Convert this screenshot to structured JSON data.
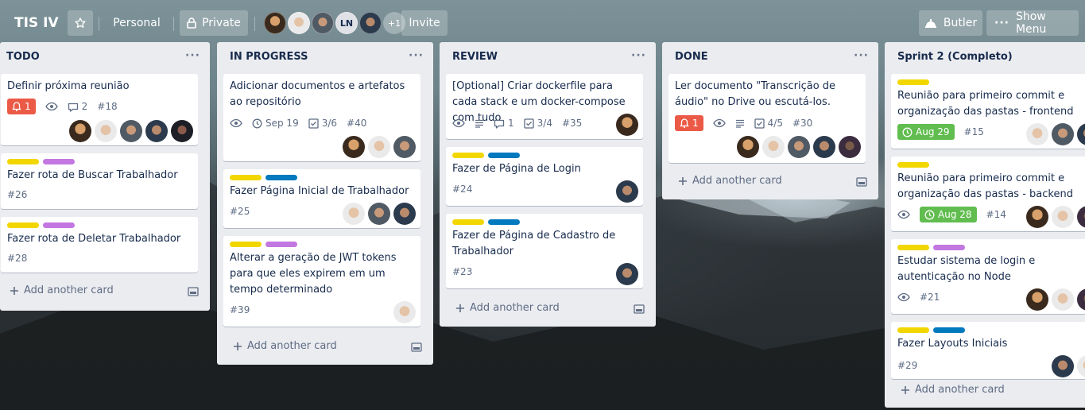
{
  "header": {
    "board_title": "TIS IV",
    "personal_label": "Personal",
    "private_label": "Private",
    "member_initials": "LN",
    "members_more": "+1",
    "invite_label": "Invite",
    "butler_label": "Butler",
    "show_menu_label": "Show Menu"
  },
  "lists": [
    {
      "title": "TODO",
      "add_card": "Add another card",
      "cards": [
        {
          "title": "Definir próxima reunião",
          "notify": "1",
          "comments": "2",
          "id": "#18"
        },
        {
          "title": "Fazer rota de Buscar Trabalhador",
          "id": "#26"
        },
        {
          "title": "Fazer rota de Deletar Trabalhador",
          "id": "#28"
        }
      ]
    },
    {
      "title": "IN PROGRESS",
      "add_card": "Add another card",
      "cards": [
        {
          "title": "Adicionar documentos e artefatos ao repositório",
          "due": "Sep 19",
          "checklist": "3/6",
          "id": "#40"
        },
        {
          "title": "Fazer Página Inicial de Trabalhador",
          "id": "#25"
        },
        {
          "title": "Alterar a geração de JWT tokens para que eles expirem em um tempo determinado",
          "id": "#39"
        }
      ]
    },
    {
      "title": "REVIEW",
      "add_card": "Add another card",
      "cards": [
        {
          "title": "[Optional] Criar dockerfile para cada stack e um docker-compose com tudo",
          "comments": "1",
          "checklist": "3/4",
          "id": "#35"
        },
        {
          "title": "Fazer de Página de Login",
          "id": "#24"
        },
        {
          "title": "Fazer de Página de Cadastro de Trabalhador",
          "id": "#23"
        }
      ]
    },
    {
      "title": "DONE",
      "add_card": "Add another card",
      "cards": [
        {
          "title": "Ler documento \"Transcrição de áudio\" no Drive ou escutá-los.",
          "notify": "1",
          "checklist": "4/5",
          "id": "#30"
        }
      ]
    },
    {
      "title": "Sprint 2 (Completo)",
      "add_card": "Add another card",
      "cards": [
        {
          "title": "Reunião para primeiro commit e organização das pastas - frontend",
          "due": "Aug 29",
          "id": "#15"
        },
        {
          "title": "Reunião para primeiro commit e organização das pastas - backend",
          "due": "Aug 28",
          "id": "#14"
        },
        {
          "title": "Estudar sistema de login e autenticação no Node",
          "id": "#21"
        },
        {
          "title": "Fazer Layouts Iniciais",
          "id": "#29"
        }
      ]
    }
  ],
  "colors": {
    "label_yellow": "#f2d600",
    "label_purple": "#c377e0",
    "label_blue": "#0079bf",
    "badge_red": "#eb5a46",
    "badge_green": "#61bd4f",
    "list_bg": "#ebecf0"
  },
  "icons": [
    "star-icon",
    "lock-icon",
    "bell-icon",
    "eye-icon",
    "comment-icon",
    "clock-icon",
    "checklist-icon",
    "description-icon",
    "plus-icon",
    "card-template-icon",
    "butler-icon",
    "more-icon"
  ]
}
